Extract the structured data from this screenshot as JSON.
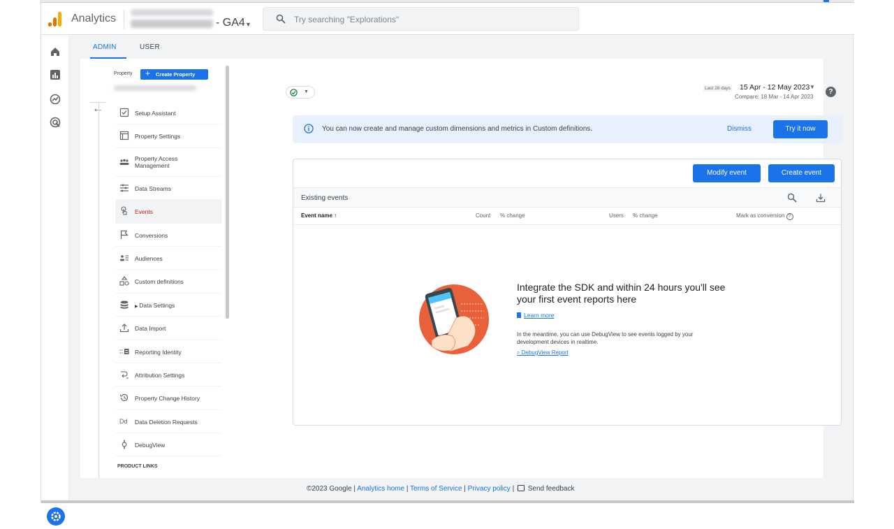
{
  "header": {
    "app_title": "Analytics",
    "property_suffix": "- GA4",
    "search_placeholder": "Try searching \"Explorations\""
  },
  "tabs": [
    {
      "label": "ADMIN",
      "active": true
    },
    {
      "label": "USER",
      "active": false
    }
  ],
  "leftnav": {
    "property_label": "Property",
    "create_property_label": "Create Property",
    "items": [
      {
        "label": "Setup Assistant",
        "icon": "checkbox-icon"
      },
      {
        "label": "Property Settings",
        "icon": "settings-page-icon"
      },
      {
        "label": "Property Access Management",
        "icon": "people-icon"
      },
      {
        "label": "Data Streams",
        "icon": "streams-icon"
      },
      {
        "label": "Events",
        "icon": "touch-icon",
        "active": true
      },
      {
        "label": "Conversions",
        "icon": "flag-icon"
      },
      {
        "label": "Audiences",
        "icon": "audiences-icon"
      },
      {
        "label": "Custom definitions",
        "icon": "shapes-icon"
      },
      {
        "label": "Data Settings",
        "icon": "database-icon"
      },
      {
        "label": "Data Import",
        "icon": "upload-icon"
      },
      {
        "label": "Reporting Identity",
        "icon": "identity-icon"
      },
      {
        "label": "Attribution Settings",
        "icon": "attribution-icon"
      },
      {
        "label": "Property Change History",
        "icon": "history-icon"
      },
      {
        "label": "Data Deletion Requests",
        "icon": "deletion-icon"
      },
      {
        "label": "DebugView",
        "icon": "debug-icon"
      }
    ],
    "product_links": "PRODUCT LINKS"
  },
  "daterange": {
    "preset": "Last 28 days",
    "range": "15 Apr - 12 May 2023",
    "compare": "Compare: 18 Mar - 14 Apr 2023"
  },
  "banner": {
    "message": "You can now create and manage custom dimensions and metrics in Custom definitions.",
    "dismiss": "Dismiss",
    "try": "Try it now"
  },
  "events": {
    "modify": "Modify event",
    "create": "Create event",
    "section_title": "Existing events",
    "columns": {
      "name": "Event name",
      "count": "Count",
      "count_change": "% change",
      "users": "Users",
      "users_change": "% change",
      "conversion": "Mark as conversion"
    },
    "empty": {
      "title": "Integrate the SDK and within 24 hours you'll see your first event reports here",
      "learn_more": "Learn more",
      "meantime": "In the meantime, you can use DebugView to see events logged by your development devices in realtime.",
      "debug_link": "DebugView Report"
    }
  },
  "footer": {
    "copyright": "©2023 Google |",
    "links": [
      "Analytics home",
      "Terms of Service",
      "Privacy policy"
    ],
    "feedback": "Send feedback"
  },
  "colors": {
    "accent": "#1a73e8",
    "active_nav": "#c5221f",
    "logo": [
      "#f9ab00",
      "#e37400",
      "#e37400"
    ]
  }
}
